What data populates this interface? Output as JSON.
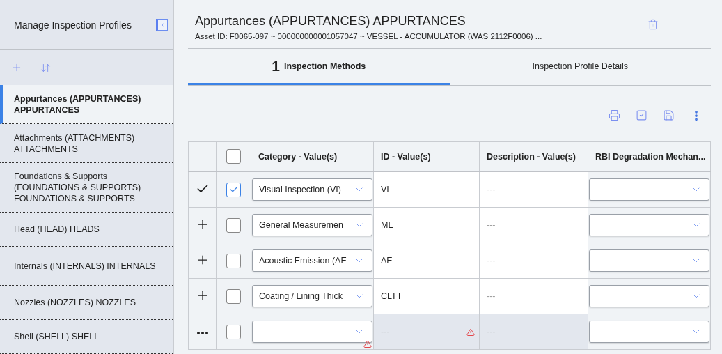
{
  "sidebar": {
    "title": "Manage Inspection Profiles",
    "items": [
      {
        "label": "Appurtances (APPURTANCES) APPURTANCES",
        "selected": true
      },
      {
        "label": "Attachments (ATTACHMENTS) ATTACHMENTS",
        "selected": false
      },
      {
        "label": "Foundations & Supports (FOUNDATIONS & SUPPORTS) FOUNDATIONS & SUPPORTS",
        "selected": false
      },
      {
        "label": "Head (HEAD) HEADS",
        "selected": false
      },
      {
        "label": "Internals (INTERNALS) INTERNALS",
        "selected": false
      },
      {
        "label": "Nozzles (NOZZLES) NOZZLES",
        "selected": false
      },
      {
        "label": "Shell (SHELL) SHELL",
        "selected": false
      }
    ]
  },
  "header": {
    "title": "Appurtances (APPURTANCES) APPURTANCES",
    "subtitle": "Asset ID: F0065-097 ~ 000000000001057047 ~ VESSEL - ACCUMULATOR (WAS 2112F0006) ..."
  },
  "tabs": [
    {
      "number": "1",
      "label": "Inspection Methods",
      "selected": true
    },
    {
      "label": "Inspection Profile Details",
      "selected": false
    }
  ],
  "table": {
    "all_checked": false,
    "columns": [
      "Category - Value(s)",
      "ID - Value(s)",
      "Description - Value(s)",
      "RBI Degradation Mechan..."
    ],
    "rows": [
      {
        "kind": "current",
        "checked": true,
        "category": "Visual Inspection (VI)",
        "id": "VI",
        "description": "---"
      },
      {
        "kind": "addable",
        "checked": false,
        "category": "General Measuremen",
        "id": "ML",
        "description": "---"
      },
      {
        "kind": "addable",
        "checked": false,
        "category": "Acoustic Emission (AE",
        "id": "AE",
        "description": "---"
      },
      {
        "kind": "addable",
        "checked": false,
        "category": "Coating / Lining Thick",
        "id": "CLTT",
        "description": "---"
      },
      {
        "kind": "new",
        "checked": false,
        "category": "",
        "id": "---",
        "description": "---"
      }
    ]
  }
}
